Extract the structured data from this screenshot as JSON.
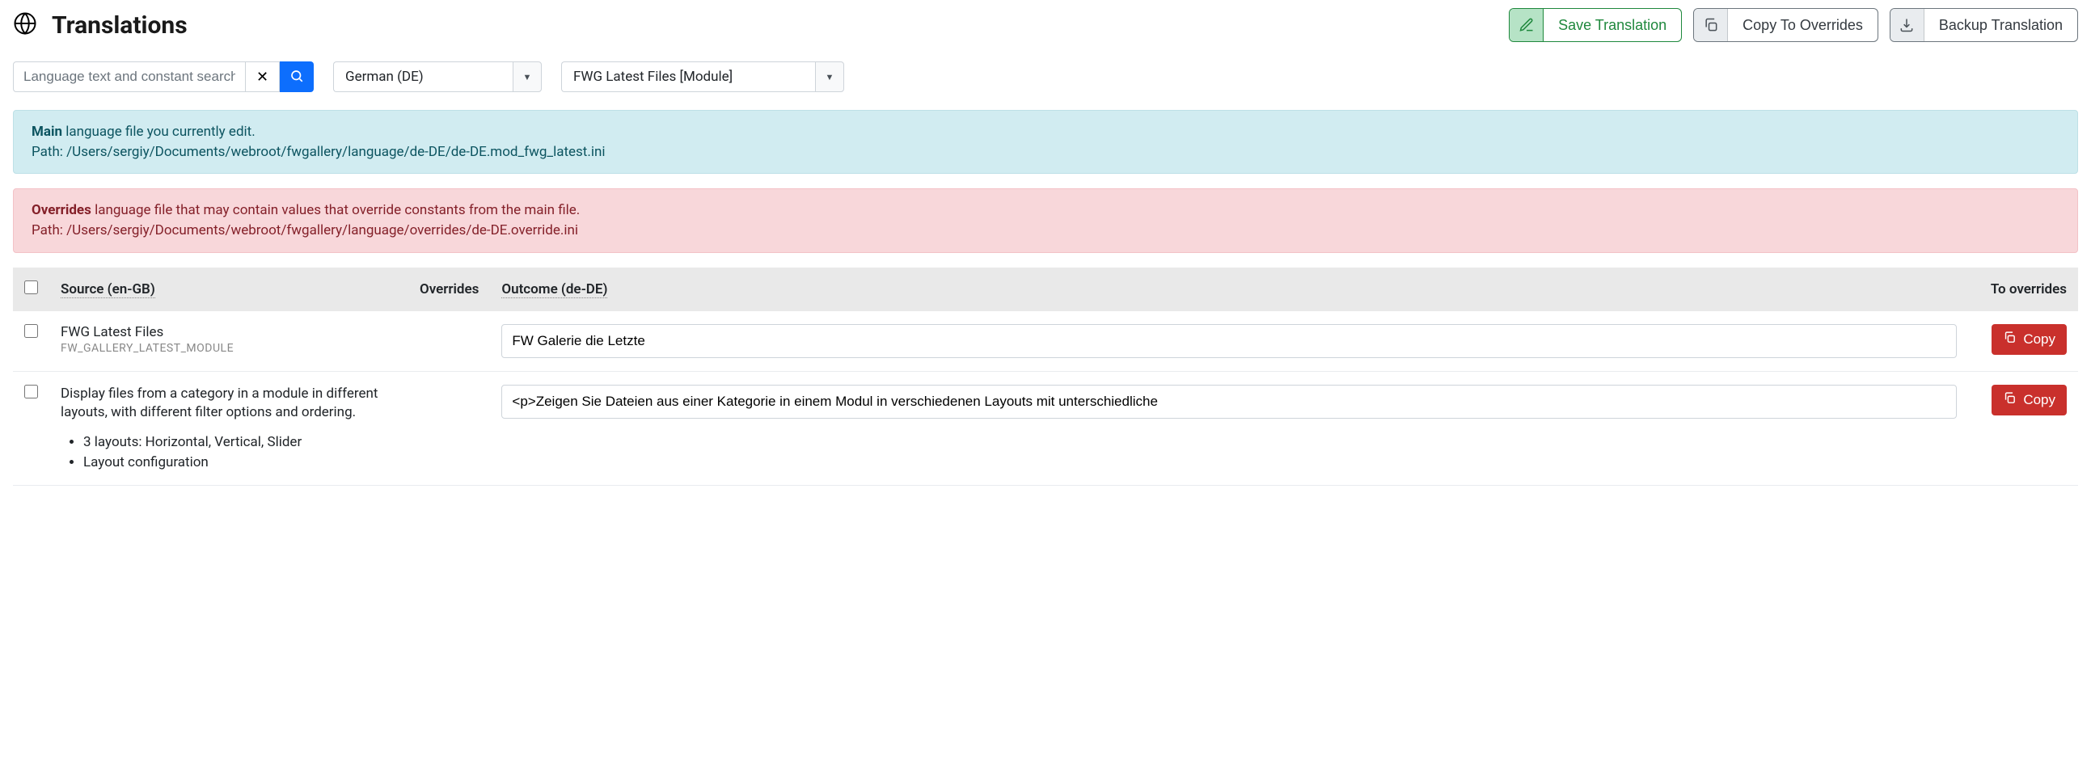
{
  "page_title": "Translations",
  "actions": {
    "save": "Save Translation",
    "copy": "Copy To Overrides",
    "backup": "Backup Translation"
  },
  "filters": {
    "search_placeholder": "Language text and constant search",
    "language_value": "German (DE)",
    "extension_value": "FWG Latest Files [Module]"
  },
  "alerts": {
    "main_strong": "Main",
    "main_rest": "language file you currently edit.",
    "main_path_label": "Path:",
    "main_path": "/Users/sergiy/Documents/webroot/fwgallery/language/de-DE/de-DE.mod_fwg_latest.ini",
    "over_strong": "Overrides",
    "over_rest": "language file that may contain values that override constants from the main file.",
    "over_path_label": "Path:",
    "over_path": "/Users/sergiy/Documents/webroot/fwgallery/language/overrides/de-DE.override.ini"
  },
  "columns": {
    "source": "Source (en-GB)",
    "over": "Overrides",
    "outcome": "Outcome (de-DE)",
    "to_over": "To overrides"
  },
  "rows": [
    {
      "source_title": "FWG Latest Files",
      "source_constant": "FW_GALLERY_LATEST_MODULE",
      "outcome": "FW Galerie die Letzte",
      "copy_label": "Copy"
    },
    {
      "source_desc": "Display files from a category in a module in different layouts, with different filter options and ordering.",
      "bullets": [
        "3 layouts: Horizontal, Vertical, Slider",
        "Layout configuration"
      ],
      "outcome": "<p>Zeigen Sie Dateien aus einer Kategorie in einem Modul in verschiedenen Layouts mit unterschiedliche",
      "copy_label": "Copy"
    }
  ]
}
